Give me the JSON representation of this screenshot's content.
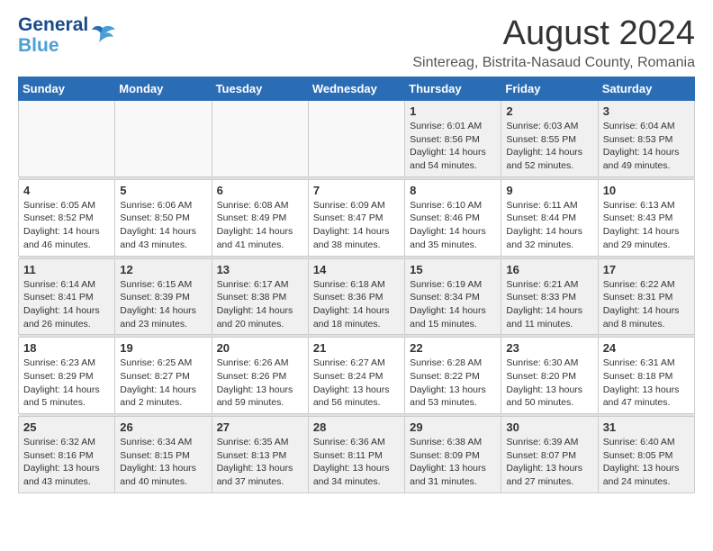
{
  "logo": {
    "line1": "General",
    "line2": "Blue"
  },
  "title": "August 2024",
  "subtitle": "Sintereag, Bistrita-Nasaud County, Romania",
  "weekdays": [
    "Sunday",
    "Monday",
    "Tuesday",
    "Wednesday",
    "Thursday",
    "Friday",
    "Saturday"
  ],
  "weeks": [
    [
      {
        "day": "",
        "info": ""
      },
      {
        "day": "",
        "info": ""
      },
      {
        "day": "",
        "info": ""
      },
      {
        "day": "",
        "info": ""
      },
      {
        "day": "1",
        "info": "Sunrise: 6:01 AM\nSunset: 8:56 PM\nDaylight: 14 hours\nand 54 minutes."
      },
      {
        "day": "2",
        "info": "Sunrise: 6:03 AM\nSunset: 8:55 PM\nDaylight: 14 hours\nand 52 minutes."
      },
      {
        "day": "3",
        "info": "Sunrise: 6:04 AM\nSunset: 8:53 PM\nDaylight: 14 hours\nand 49 minutes."
      }
    ],
    [
      {
        "day": "4",
        "info": "Sunrise: 6:05 AM\nSunset: 8:52 PM\nDaylight: 14 hours\nand 46 minutes."
      },
      {
        "day": "5",
        "info": "Sunrise: 6:06 AM\nSunset: 8:50 PM\nDaylight: 14 hours\nand 43 minutes."
      },
      {
        "day": "6",
        "info": "Sunrise: 6:08 AM\nSunset: 8:49 PM\nDaylight: 14 hours\nand 41 minutes."
      },
      {
        "day": "7",
        "info": "Sunrise: 6:09 AM\nSunset: 8:47 PM\nDaylight: 14 hours\nand 38 minutes."
      },
      {
        "day": "8",
        "info": "Sunrise: 6:10 AM\nSunset: 8:46 PM\nDaylight: 14 hours\nand 35 minutes."
      },
      {
        "day": "9",
        "info": "Sunrise: 6:11 AM\nSunset: 8:44 PM\nDaylight: 14 hours\nand 32 minutes."
      },
      {
        "day": "10",
        "info": "Sunrise: 6:13 AM\nSunset: 8:43 PM\nDaylight: 14 hours\nand 29 minutes."
      }
    ],
    [
      {
        "day": "11",
        "info": "Sunrise: 6:14 AM\nSunset: 8:41 PM\nDaylight: 14 hours\nand 26 minutes."
      },
      {
        "day": "12",
        "info": "Sunrise: 6:15 AM\nSunset: 8:39 PM\nDaylight: 14 hours\nand 23 minutes."
      },
      {
        "day": "13",
        "info": "Sunrise: 6:17 AM\nSunset: 8:38 PM\nDaylight: 14 hours\nand 20 minutes."
      },
      {
        "day": "14",
        "info": "Sunrise: 6:18 AM\nSunset: 8:36 PM\nDaylight: 14 hours\nand 18 minutes."
      },
      {
        "day": "15",
        "info": "Sunrise: 6:19 AM\nSunset: 8:34 PM\nDaylight: 14 hours\nand 15 minutes."
      },
      {
        "day": "16",
        "info": "Sunrise: 6:21 AM\nSunset: 8:33 PM\nDaylight: 14 hours\nand 11 minutes."
      },
      {
        "day": "17",
        "info": "Sunrise: 6:22 AM\nSunset: 8:31 PM\nDaylight: 14 hours\nand 8 minutes."
      }
    ],
    [
      {
        "day": "18",
        "info": "Sunrise: 6:23 AM\nSunset: 8:29 PM\nDaylight: 14 hours\nand 5 minutes."
      },
      {
        "day": "19",
        "info": "Sunrise: 6:25 AM\nSunset: 8:27 PM\nDaylight: 14 hours\nand 2 minutes."
      },
      {
        "day": "20",
        "info": "Sunrise: 6:26 AM\nSunset: 8:26 PM\nDaylight: 13 hours\nand 59 minutes."
      },
      {
        "day": "21",
        "info": "Sunrise: 6:27 AM\nSunset: 8:24 PM\nDaylight: 13 hours\nand 56 minutes."
      },
      {
        "day": "22",
        "info": "Sunrise: 6:28 AM\nSunset: 8:22 PM\nDaylight: 13 hours\nand 53 minutes."
      },
      {
        "day": "23",
        "info": "Sunrise: 6:30 AM\nSunset: 8:20 PM\nDaylight: 13 hours\nand 50 minutes."
      },
      {
        "day": "24",
        "info": "Sunrise: 6:31 AM\nSunset: 8:18 PM\nDaylight: 13 hours\nand 47 minutes."
      }
    ],
    [
      {
        "day": "25",
        "info": "Sunrise: 6:32 AM\nSunset: 8:16 PM\nDaylight: 13 hours\nand 43 minutes."
      },
      {
        "day": "26",
        "info": "Sunrise: 6:34 AM\nSunset: 8:15 PM\nDaylight: 13 hours\nand 40 minutes."
      },
      {
        "day": "27",
        "info": "Sunrise: 6:35 AM\nSunset: 8:13 PM\nDaylight: 13 hours\nand 37 minutes."
      },
      {
        "day": "28",
        "info": "Sunrise: 6:36 AM\nSunset: 8:11 PM\nDaylight: 13 hours\nand 34 minutes."
      },
      {
        "day": "29",
        "info": "Sunrise: 6:38 AM\nSunset: 8:09 PM\nDaylight: 13 hours\nand 31 minutes."
      },
      {
        "day": "30",
        "info": "Sunrise: 6:39 AM\nSunset: 8:07 PM\nDaylight: 13 hours\nand 27 minutes."
      },
      {
        "day": "31",
        "info": "Sunrise: 6:40 AM\nSunset: 8:05 PM\nDaylight: 13 hours\nand 24 minutes."
      }
    ]
  ]
}
